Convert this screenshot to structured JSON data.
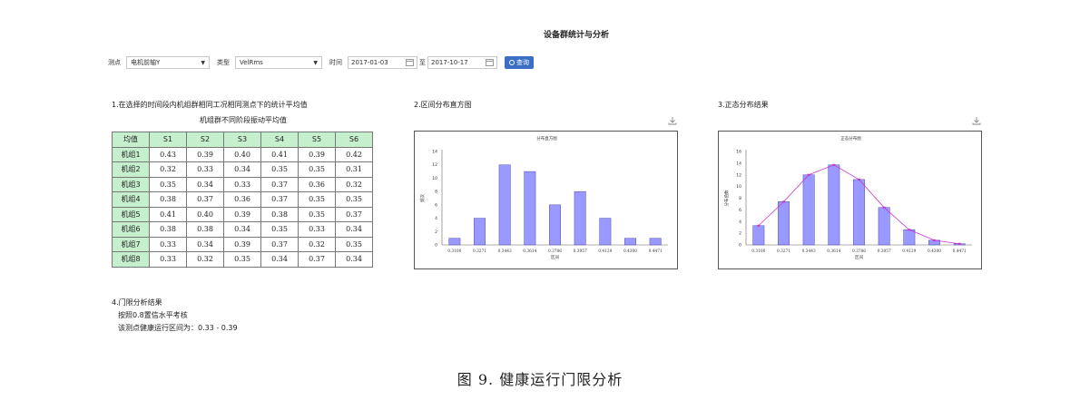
{
  "page_title": "设备群统计与分析",
  "filters": {
    "point_label": "测点",
    "point_value": "电机前轴Y",
    "type_label": "类型",
    "type_value": "VelRms",
    "time_label": "时间",
    "date_from": "2017-01-03",
    "to_label": "至",
    "date_to": "2017-10-17",
    "query_label": "查询"
  },
  "section1": {
    "title": "1.在选择的时间段内机组群相同工况相同测点下的统计平均值",
    "table_caption": "机组群不同阶段振动平均值",
    "header": [
      "均值",
      "S1",
      "S2",
      "S3",
      "S4",
      "S5",
      "S6"
    ],
    "rows": [
      {
        "name": "机组1",
        "values": [
          "0.43",
          "0.39",
          "0.40",
          "0.41",
          "0.39",
          "0.42"
        ]
      },
      {
        "name": "机组2",
        "values": [
          "0.32",
          "0.33",
          "0.34",
          "0.35",
          "0.35",
          "0.31"
        ]
      },
      {
        "name": "机组3",
        "values": [
          "0.35",
          "0.34",
          "0.33",
          "0.37",
          "0.36",
          "0.32"
        ]
      },
      {
        "name": "机组4",
        "values": [
          "0.38",
          "0.37",
          "0.36",
          "0.37",
          "0.35",
          "0.35"
        ]
      },
      {
        "name": "机组5",
        "values": [
          "0.41",
          "0.40",
          "0.39",
          "0.38",
          "0.35",
          "0.37"
        ]
      },
      {
        "name": "机组6",
        "values": [
          "0.38",
          "0.38",
          "0.34",
          "0.35",
          "0.33",
          "0.34"
        ]
      },
      {
        "name": "机组7",
        "values": [
          "0.33",
          "0.34",
          "0.39",
          "0.37",
          "0.32",
          "0.35"
        ]
      },
      {
        "name": "机组8",
        "values": [
          "0.33",
          "0.32",
          "0.35",
          "0.34",
          "0.37",
          "0.34"
        ]
      }
    ]
  },
  "section2": {
    "title": "2.区间分布直方图"
  },
  "section3": {
    "title": "3.正态分布结果"
  },
  "section4": {
    "title": "4.门限分析结果",
    "line1": "按照0.8置信水平考核",
    "line2": "该测点健康运行区间为：0.33 - 0.39"
  },
  "figure_caption": "图 9. 健康运行门限分析",
  "colors": {
    "bar_fill": "#9999ff",
    "bar_stroke": "#333399",
    "curve": "#cc33cc",
    "header_bg": "#c6efce",
    "query_btn": "#3b6fc4"
  },
  "chart_data": [
    {
      "type": "bar",
      "title": "分布直方图",
      "xlabel": "区间",
      "ylabel": "频次",
      "categories": [
        "0.3100",
        "0.3271",
        "0.3443",
        "0.3614",
        "0.3786",
        "0.3957",
        "0.4129",
        "0.4300",
        "0.4471"
      ],
      "values": [
        1,
        4,
        12,
        11,
        6,
        8,
        4,
        1,
        1
      ],
      "ylim": [
        0,
        14
      ],
      "yticks": [
        0,
        2,
        4,
        6,
        8,
        10,
        12,
        14
      ]
    },
    {
      "type": "bar",
      "title": "正态分布图",
      "xlabel": "区间",
      "ylabel": "分布函数",
      "categories": [
        "0.3100",
        "0.3271",
        "0.3443",
        "0.3614",
        "0.3786",
        "0.3957",
        "0.4129",
        "0.4300",
        "0.4471"
      ],
      "values": [
        3.3,
        7.4,
        12,
        13.7,
        11.2,
        6.4,
        2.6,
        0.8,
        0.2
      ],
      "ylim": [
        0,
        16
      ],
      "yticks": [
        0,
        2,
        4,
        6,
        8,
        10,
        12,
        14,
        16
      ]
    }
  ]
}
